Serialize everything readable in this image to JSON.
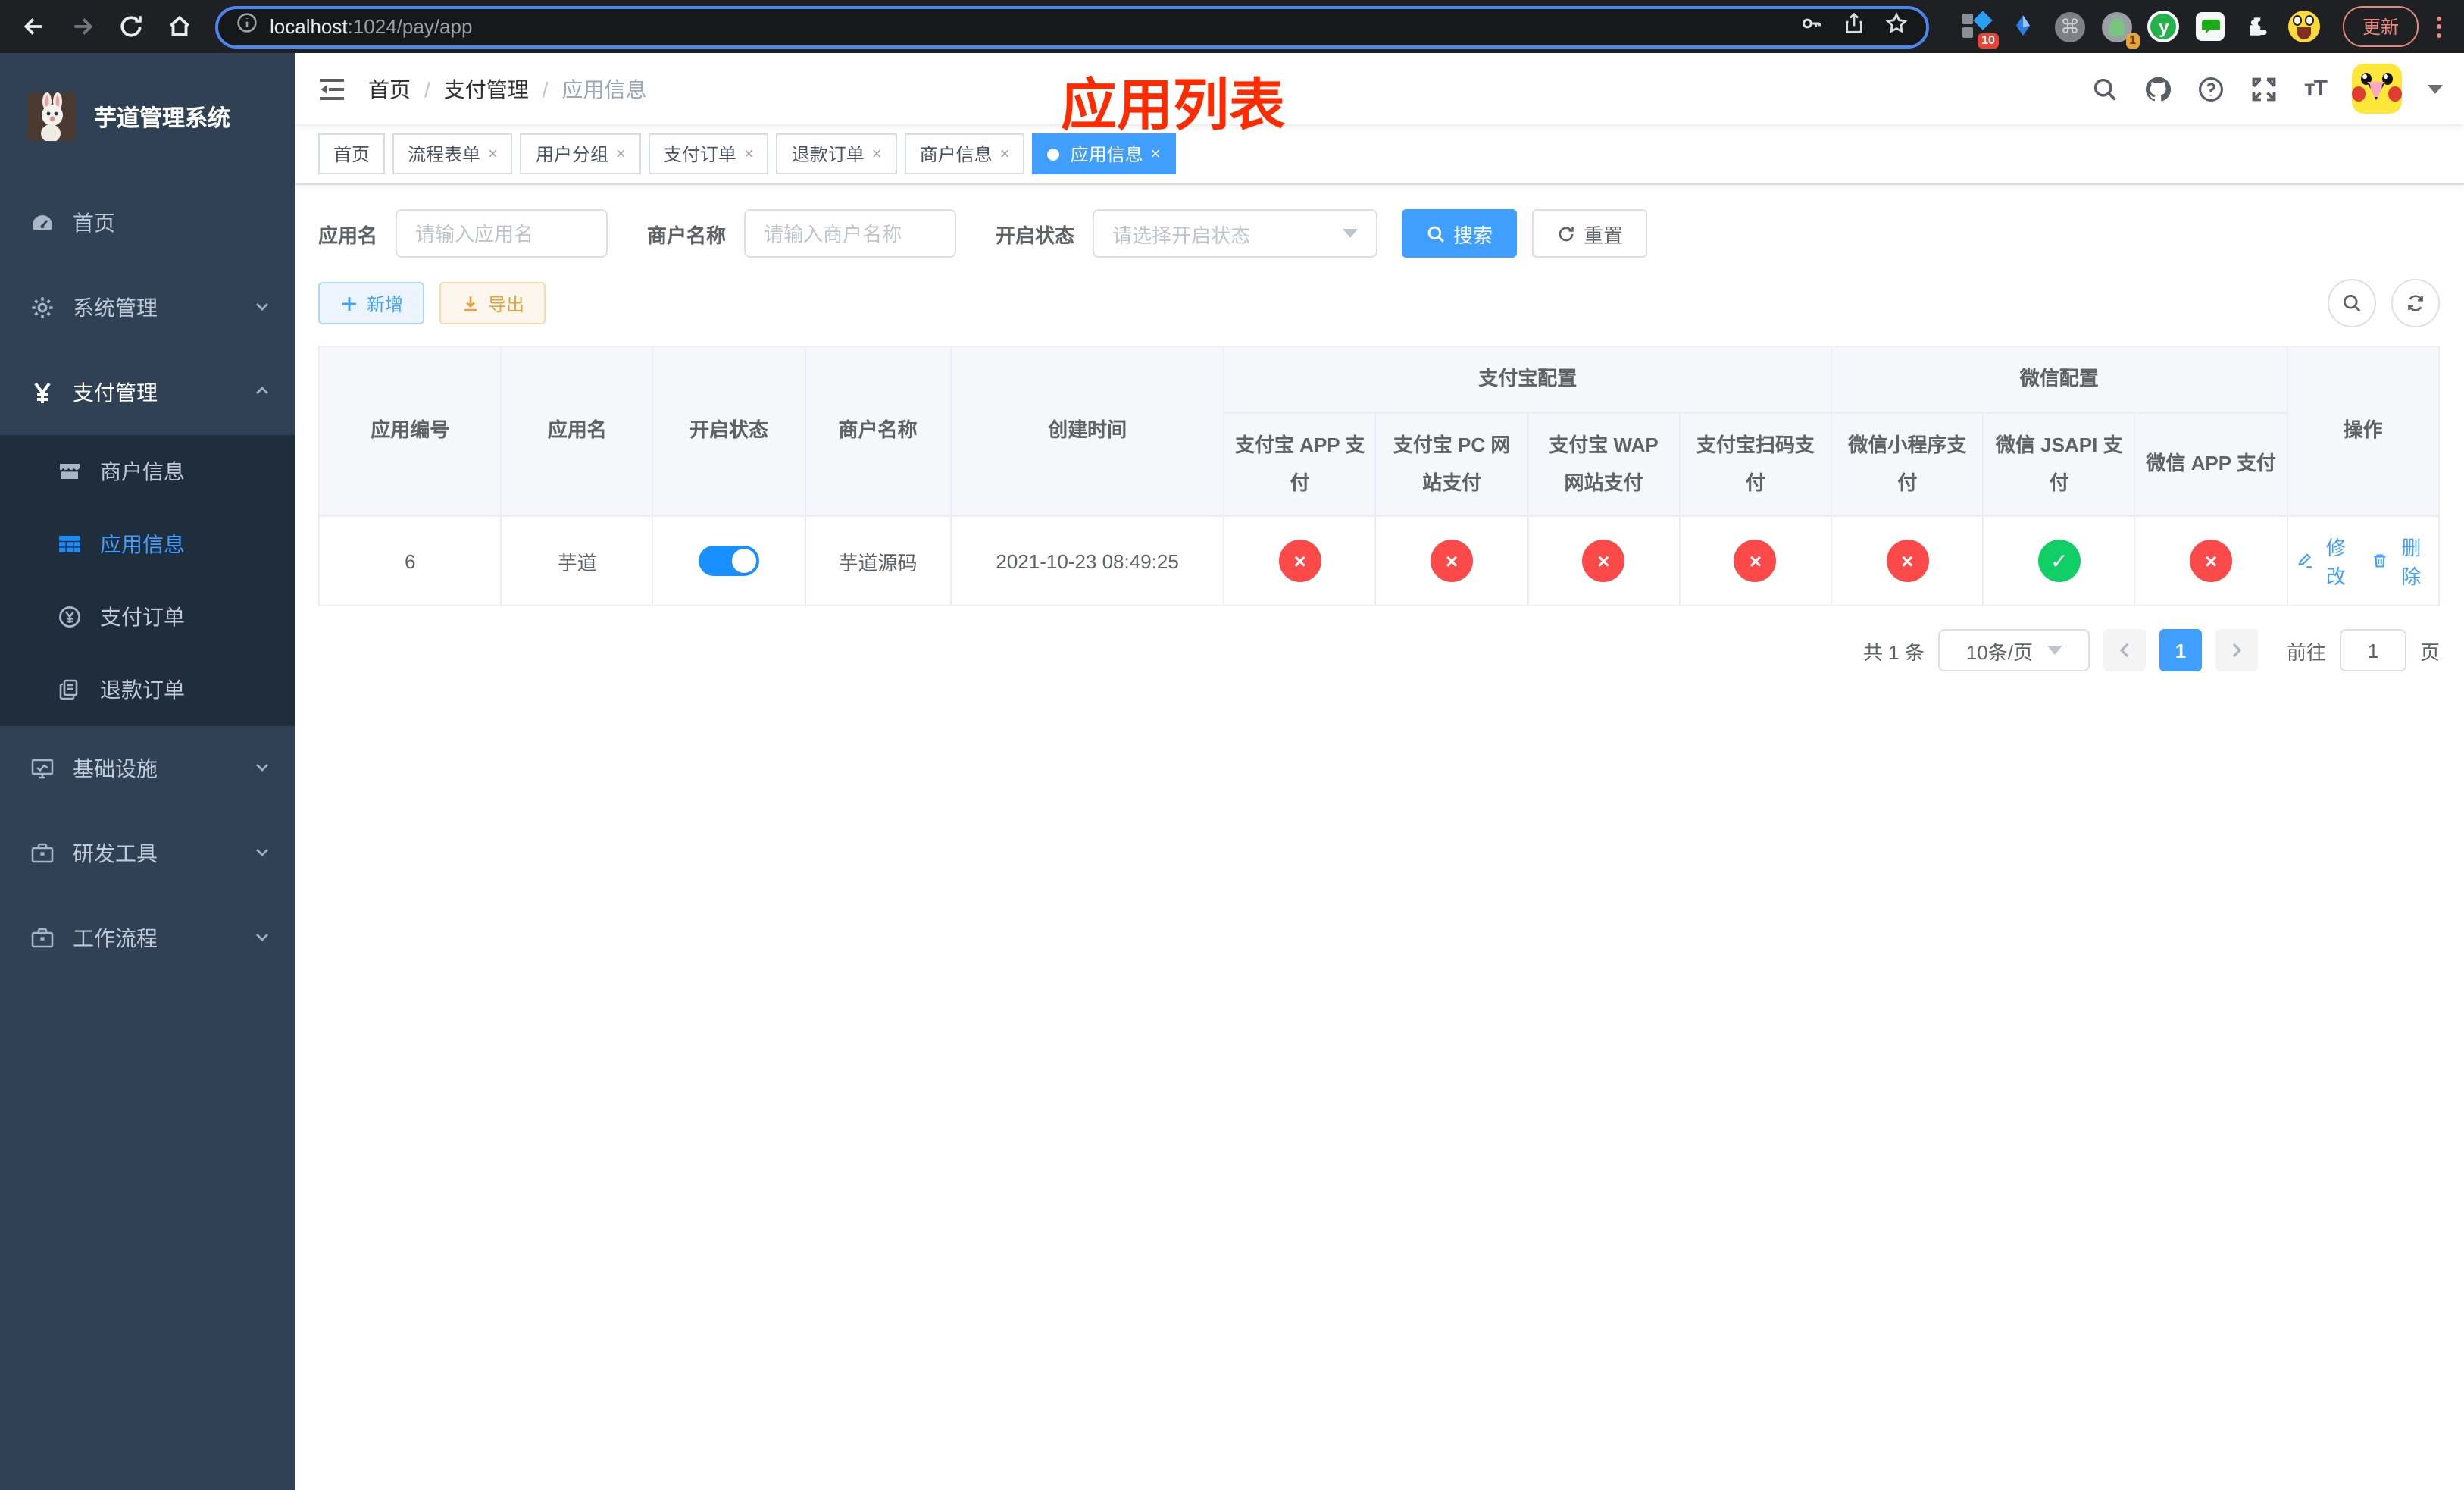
{
  "colors": {
    "primary": "#409eff",
    "success": "#12ce66",
    "danger": "#fc4a4a",
    "sidebar_bg": "#304156",
    "submenu_bg": "#1f2d3d",
    "annotation": "#ff2b00"
  },
  "icons": {
    "close": "×",
    "cross": "×",
    "check": "✓",
    "command": "⌘",
    "y_ext": "y"
  },
  "browser": {
    "url_host": "localhost",
    "url_rest": ":1024/pay/app",
    "update_label": "更新",
    "ext_badge_tasks": "10",
    "ext_badge_avatar": "1"
  },
  "annotation": {
    "text": "应用列表"
  },
  "sidebar": {
    "title": "芋道管理系统",
    "items": [
      {
        "label": "首页"
      },
      {
        "label": "系统管理"
      },
      {
        "label": "支付管理"
      },
      {
        "label": "商户信息"
      },
      {
        "label": "应用信息"
      },
      {
        "label": "支付订单"
      },
      {
        "label": "退款订单"
      },
      {
        "label": "基础设施"
      },
      {
        "label": "研发工具"
      },
      {
        "label": "工作流程"
      }
    ]
  },
  "breadcrumb": {
    "separator": "/",
    "items": [
      {
        "label": "首页"
      },
      {
        "label": "支付管理"
      },
      {
        "label": "应用信息"
      }
    ]
  },
  "tabs": [
    {
      "label": "首页",
      "closable": false
    },
    {
      "label": "流程表单",
      "closable": true
    },
    {
      "label": "用户分组",
      "closable": true
    },
    {
      "label": "支付订单",
      "closable": true
    },
    {
      "label": "退款订单",
      "closable": true
    },
    {
      "label": "商户信息",
      "closable": true
    },
    {
      "label": "应用信息",
      "closable": true,
      "active": true
    }
  ],
  "filters": {
    "app_name_label": "应用名",
    "app_name_placeholder": "请输入应用名",
    "merchant_label": "商户名称",
    "merchant_placeholder": "请输入商户名称",
    "status_label": "开启状态",
    "status_placeholder": "请选择开启状态",
    "search_label": "搜索",
    "reset_label": "重置"
  },
  "toolbar": {
    "add_label": "新增",
    "export_label": "导出"
  },
  "table": {
    "col_app_id": "应用编号",
    "col_app_name": "应用名",
    "col_status": "开启状态",
    "col_merchant": "商户名称",
    "col_created": "创建时间",
    "group_alipay": "支付宝配置",
    "group_wechat": "微信配置",
    "col_actions": "操作",
    "sub": [
      "支付宝 APP 支付",
      "支付宝 PC 网站支付",
      "支付宝 WAP 网站支付",
      "支付宝扫码支付",
      "微信小程序支付",
      "微信 JSAPI 支付",
      "微信 APP 支付"
    ],
    "row": {
      "app_id": "6",
      "app_name": "芋道",
      "status_on": true,
      "merchant": "芋道源码",
      "created": "2021-10-23 08:49:25",
      "pay_status": [
        "no",
        "no",
        "no",
        "no",
        "no",
        "yes",
        "no"
      ],
      "edit_label": "修改",
      "delete_label": "删除"
    }
  },
  "pagination": {
    "total_text": "共 1 条",
    "page_size": "10条/页",
    "page": "1",
    "goto_label": "前往",
    "goto_value": "1",
    "page_unit": "页"
  }
}
